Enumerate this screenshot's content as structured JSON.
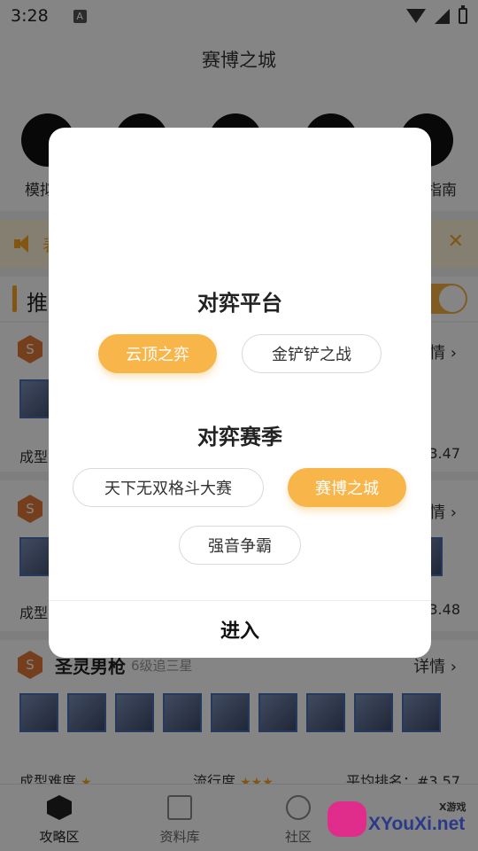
{
  "status_bar": {
    "time": "3:28",
    "badge": "A"
  },
  "app": {
    "title": "赛博之城"
  },
  "quick_icons": [
    {
      "label": "模拟",
      "icon": "simulator-icon"
    },
    {
      "label": "",
      "icon": "book-icon"
    },
    {
      "label": "",
      "icon": "hat-icon"
    },
    {
      "label": "",
      "icon": "chart-icon"
    },
    {
      "label": "指南",
      "icon": "guide-icon"
    }
  ],
  "notice": {
    "text": "表"
  },
  "recommend": {
    "title": "推"
  },
  "cards": [
    {
      "badge": "S",
      "name": "",
      "sub": "",
      "detail": "情",
      "meta_left": "成型",
      "meta_mid": "",
      "meta_right": "3.47"
    },
    {
      "badge": "S",
      "name": "",
      "sub": "",
      "detail": "情",
      "meta_left": "成型",
      "meta_mid": "",
      "meta_right": "3.48"
    },
    {
      "badge": "S",
      "name": "圣灵男枪",
      "sub": "6级追三星",
      "detail": "详情",
      "meta_left": "成型难度",
      "meta_mid": "流行度",
      "meta_right": "平均排名：#3.57"
    }
  ],
  "modal": {
    "platform_title": "对弈平台",
    "platforms": [
      {
        "label": "云顶之弈",
        "selected": true
      },
      {
        "label": "金铲铲之战",
        "selected": false
      }
    ],
    "season_title": "对弈赛季",
    "seasons": [
      {
        "label": "天下无双格斗大赛",
        "selected": false
      },
      {
        "label": "赛博之城",
        "selected": true
      },
      {
        "label": "强音争霸",
        "selected": false
      }
    ],
    "enter_label": "进入"
  },
  "bottom_nav": [
    {
      "label": "攻略区",
      "icon": "cube-icon",
      "active": true
    },
    {
      "label": "资料库",
      "icon": "book-icon",
      "active": false
    },
    {
      "label": "社区",
      "icon": "chat-icon",
      "active": false
    }
  ],
  "watermark": {
    "small": "X游戏",
    "text": "XYouXi.net"
  },
  "colors": {
    "accent": "#f8b54a",
    "overlay": "rgba(0,0,0,0.48)"
  }
}
